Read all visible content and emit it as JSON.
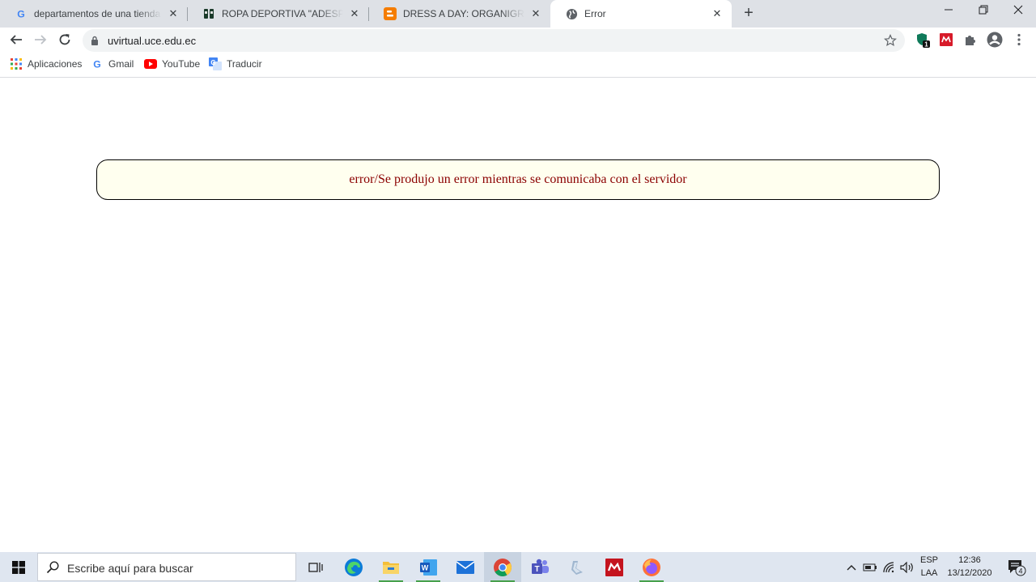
{
  "tabs": [
    {
      "title": "departamentos de una tienda de ropa - Buscar con Google",
      "icon": "google-g-icon"
    },
    {
      "title": "ROPA DEPORTIVA \"ADESPORT\": Organigrama",
      "icon": "adesport-icon"
    },
    {
      "title": "DRESS A DAY: ORGANIGRAMA Y DEPARTAMENTOS",
      "icon": "blogger-icon"
    },
    {
      "title": "Error",
      "icon": "globe-icon",
      "active": true
    }
  ],
  "address_bar": {
    "url": "uvirtual.uce.edu.ec"
  },
  "extensions": {
    "badge_count": "1"
  },
  "bookmarks": [
    {
      "label": "Aplicaciones",
      "icon": "apps-grid-icon"
    },
    {
      "label": "Gmail",
      "icon": "google-g-icon"
    },
    {
      "label": "YouTube",
      "icon": "youtube-icon"
    },
    {
      "label": "Traducir",
      "icon": "translate-icon"
    }
  ],
  "page": {
    "error_message": "error/Se produjo un error mientras se comunicaba con el servidor"
  },
  "taskbar": {
    "search_placeholder": "Escribe aquí para buscar",
    "lang_top": "ESP",
    "lang_bottom": "LAA",
    "time": "12:36",
    "date": "13/12/2020",
    "notification_count": "4"
  },
  "colors": {
    "error_text": "#8b0000",
    "error_bg": "#ffffef",
    "taskbar_bg": "#dfe6f0",
    "tabstrip_bg": "#dee1e6"
  }
}
